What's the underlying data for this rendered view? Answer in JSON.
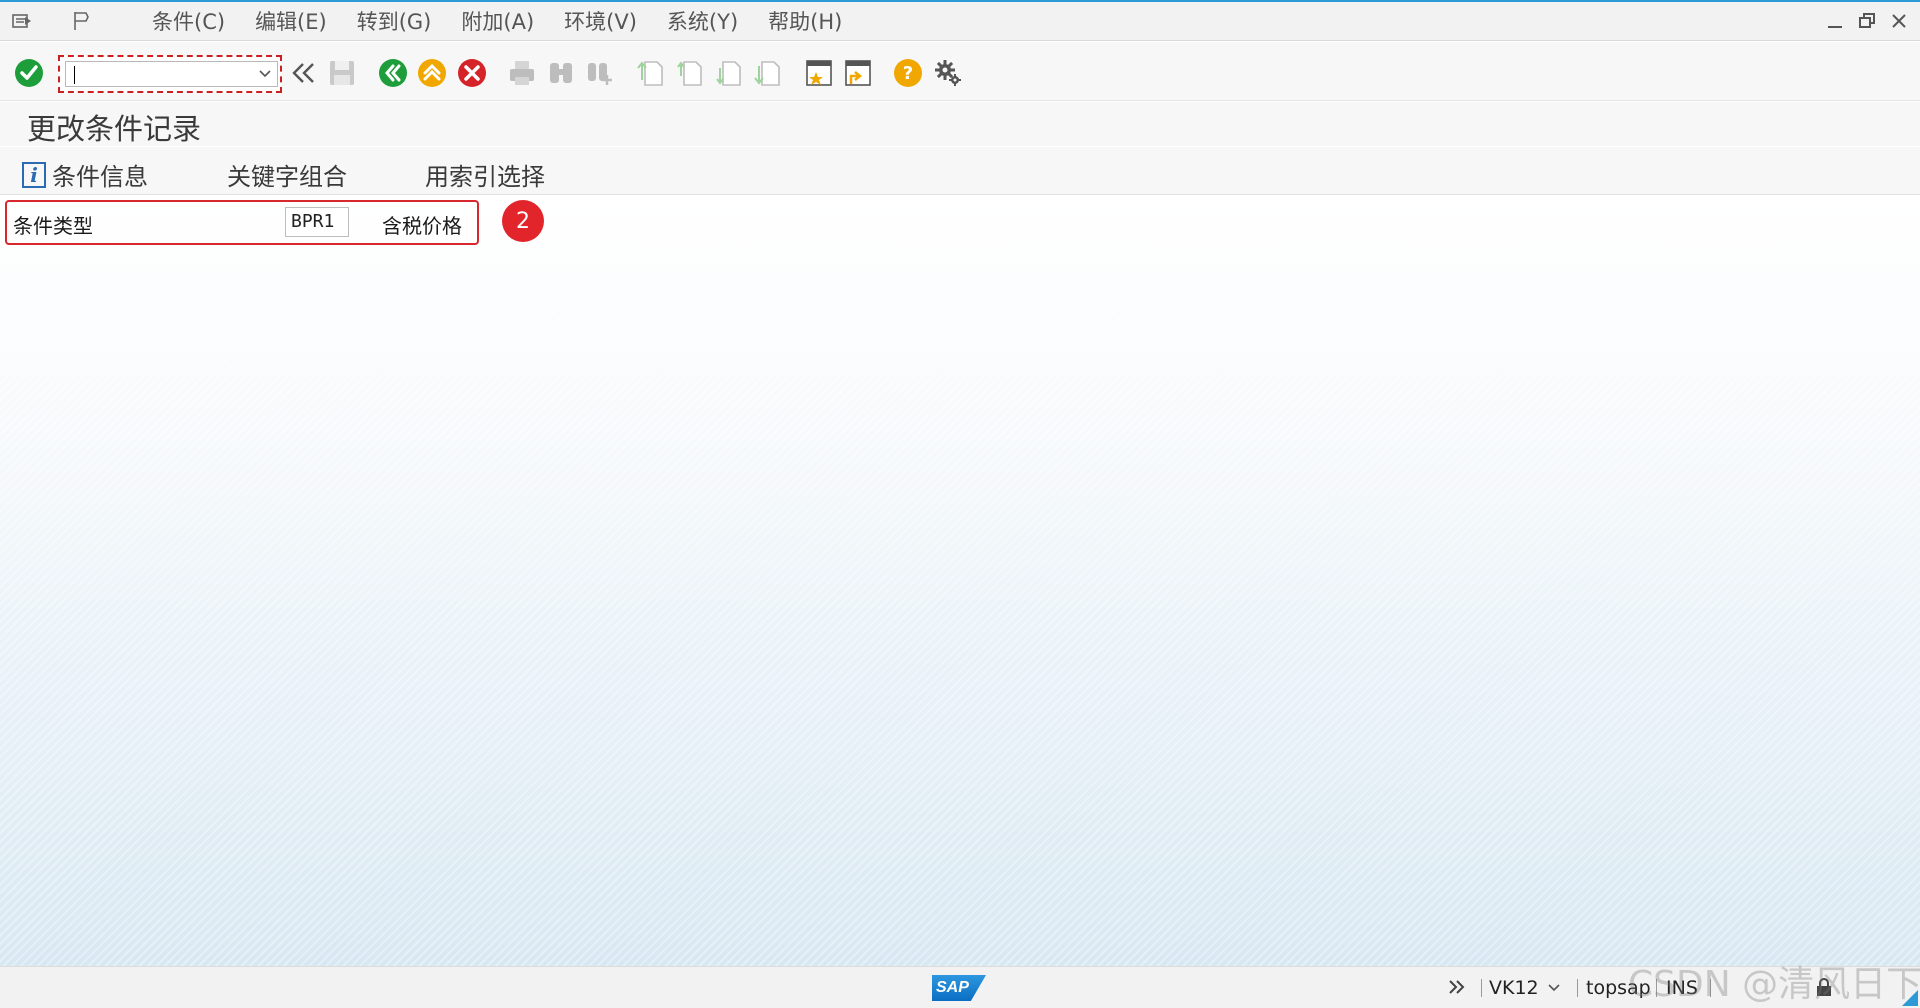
{
  "menubar": {
    "items": [
      "条件(C)",
      "编辑(E)",
      "转到(G)",
      "附加(A)",
      "环境(V)",
      "系统(Y)",
      "帮助(H)"
    ]
  },
  "toolbar": {
    "command_field_value": ""
  },
  "page": {
    "title": "更改条件记录"
  },
  "app_toolbar": {
    "condition_info": "条件信息",
    "key_combination": "关键字组合",
    "index_selection": "用索引选择"
  },
  "form": {
    "condition_type_label": "条件类型",
    "condition_type_value": "BPR1",
    "condition_type_desc": "含税价格"
  },
  "annotation": {
    "step_number": "2"
  },
  "statusbar": {
    "transaction": "VK12",
    "system": "topsap",
    "mode": "INS"
  },
  "watermark": "CSDN @清风日下"
}
